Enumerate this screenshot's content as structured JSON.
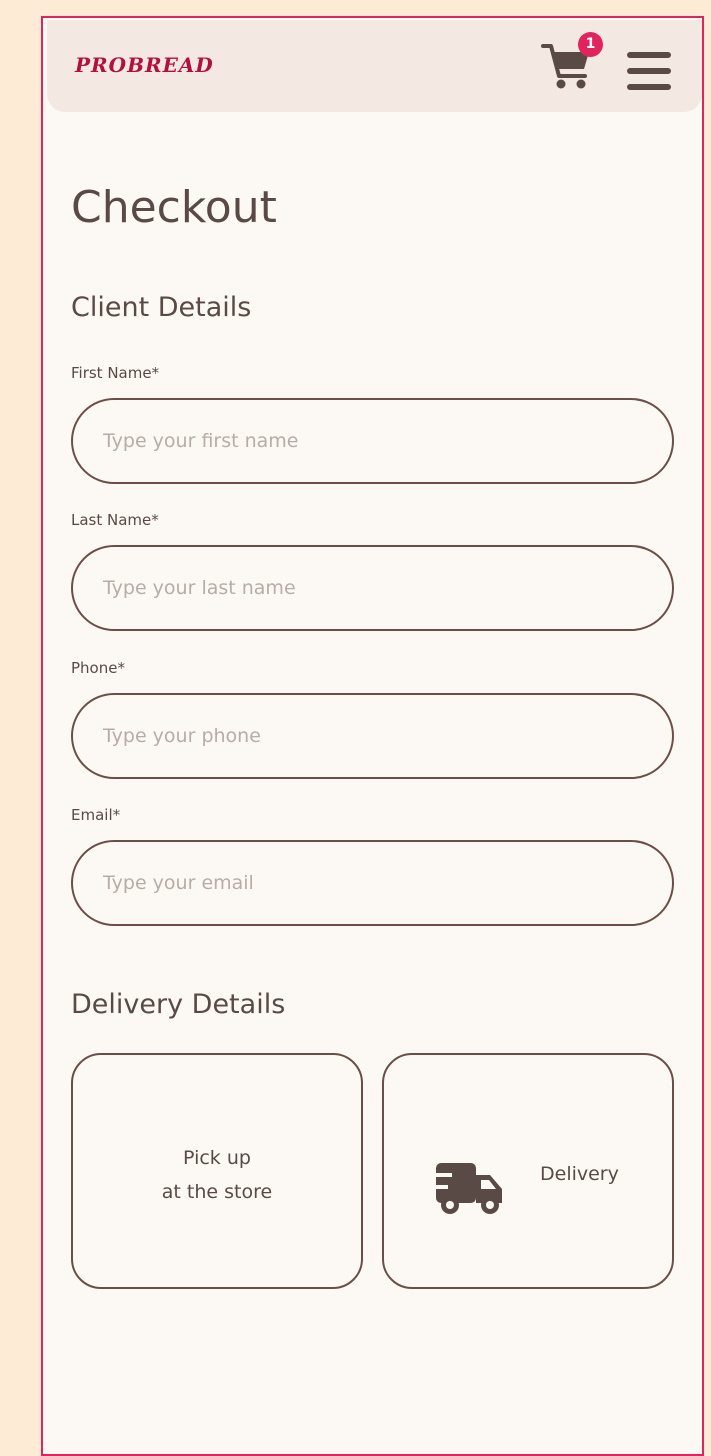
{
  "header": {
    "logo_text": "PROBREAD",
    "cart_icon": "shopping-cart-icon",
    "cart_count": "1",
    "menu_icon": "hamburger-menu-icon"
  },
  "page": {
    "title": "Checkout"
  },
  "client_details": {
    "heading": "Client Details",
    "fields": [
      {
        "label": "First Name*",
        "placeholder": "Type your first name",
        "value": ""
      },
      {
        "label": "Last Name*",
        "placeholder": "Type your last name",
        "value": ""
      },
      {
        "label": "Phone*",
        "placeholder": "Type your phone",
        "value": ""
      },
      {
        "label": "Email*",
        "placeholder": "Type your email",
        "value": ""
      }
    ]
  },
  "delivery_details": {
    "heading": "Delivery Details",
    "options": {
      "pickup_line1": "Pick up",
      "pickup_line2": "at the store",
      "delivery_label": "Delivery",
      "delivery_icon": "truck-icon"
    }
  },
  "colors": {
    "page_background": "#fdebd6",
    "frame_border": "#e0245e",
    "brand": "#b4103e",
    "badge": "#e0245e",
    "text": "#5a4a45",
    "border": "#6b4f47",
    "header_background": "#f4e9e2",
    "panel_background": "#fcf9f5",
    "placeholder": "#b8aca6"
  }
}
